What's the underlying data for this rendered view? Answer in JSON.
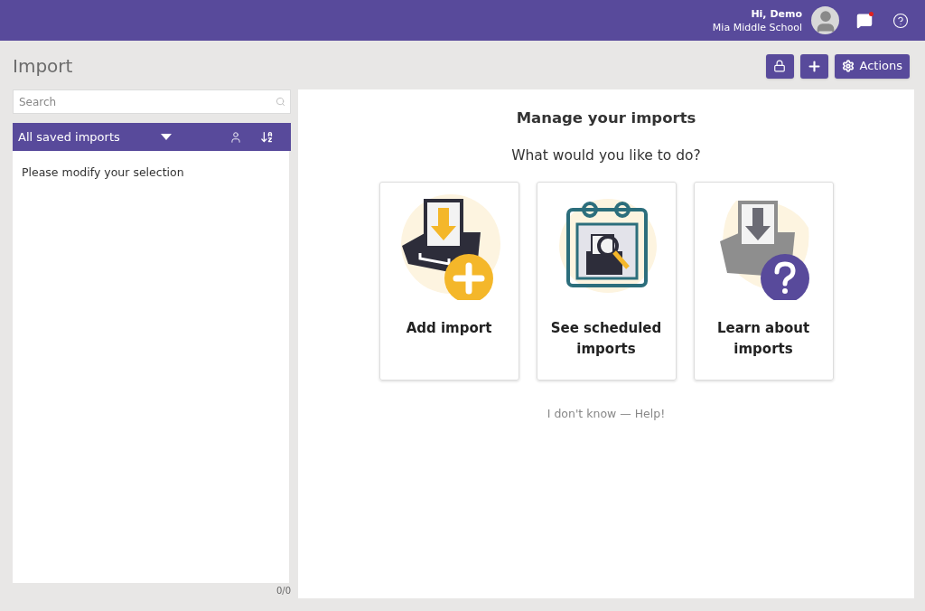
{
  "header": {
    "greeting": "Hi, Demo",
    "school": "Mia Middle School",
    "has_notification": true
  },
  "page": {
    "title": "Import",
    "toolbar": [
      {
        "kind": "lock"
      },
      {
        "kind": "add"
      },
      {
        "kind": "actions",
        "label": "Actions"
      }
    ]
  },
  "sidebar": {
    "search": {
      "placeholder": "Search"
    },
    "filter": "All saved imports",
    "empty_message": "Please modify your selection",
    "count": "0/0"
  },
  "main": {
    "title": "Manage your imports",
    "question": "What would you like to do?",
    "cards": [
      {
        "kind": "add",
        "label": "Add import"
      },
      {
        "kind": "schedule",
        "label": "See scheduled imports"
      },
      {
        "kind": "learn",
        "label": "Learn about imports"
      }
    ],
    "help_link": "I don't know — Help!"
  }
}
